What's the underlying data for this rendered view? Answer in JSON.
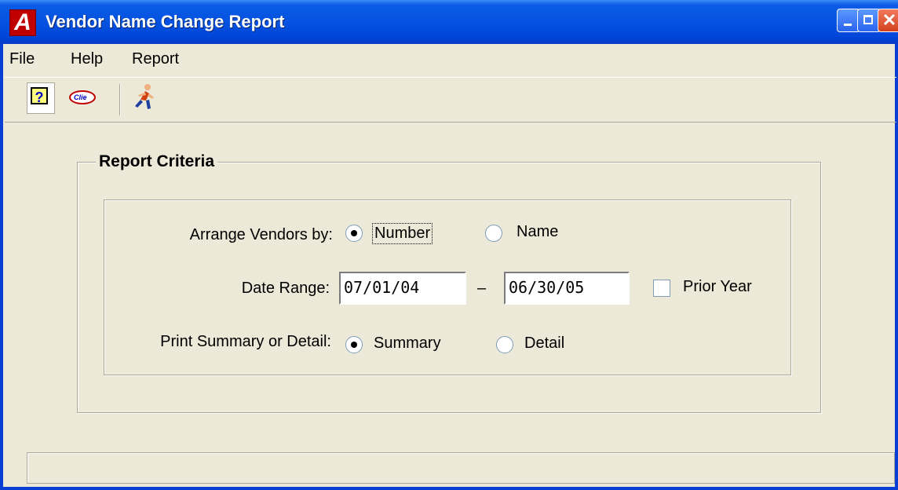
{
  "window": {
    "title": "Vendor Name Change Report",
    "app_icon_letter": "A",
    "close_glyph": "✕"
  },
  "menu": {
    "file": "File",
    "help": "Help",
    "report": "Report"
  },
  "toolbar": {
    "help_glyph": "?",
    "logo_text": "Clie"
  },
  "report_criteria": {
    "legend": "Report Criteria",
    "arrange_label": "Arrange Vendors by:",
    "arrange_options": {
      "number": "Number",
      "name": "Name"
    },
    "arrange_selected": "Number",
    "date_range_label": "Date Range:",
    "date_start": "07/01/04",
    "date_separator": "–",
    "date_end": "06/30/05",
    "prior_year_label": "Prior Year",
    "prior_year_checked": false,
    "print_label": "Print Summary or Detail:",
    "print_options": {
      "summary": "Summary",
      "detail": "Detail"
    },
    "print_selected": "Summary"
  },
  "status": {
    "text": ""
  }
}
